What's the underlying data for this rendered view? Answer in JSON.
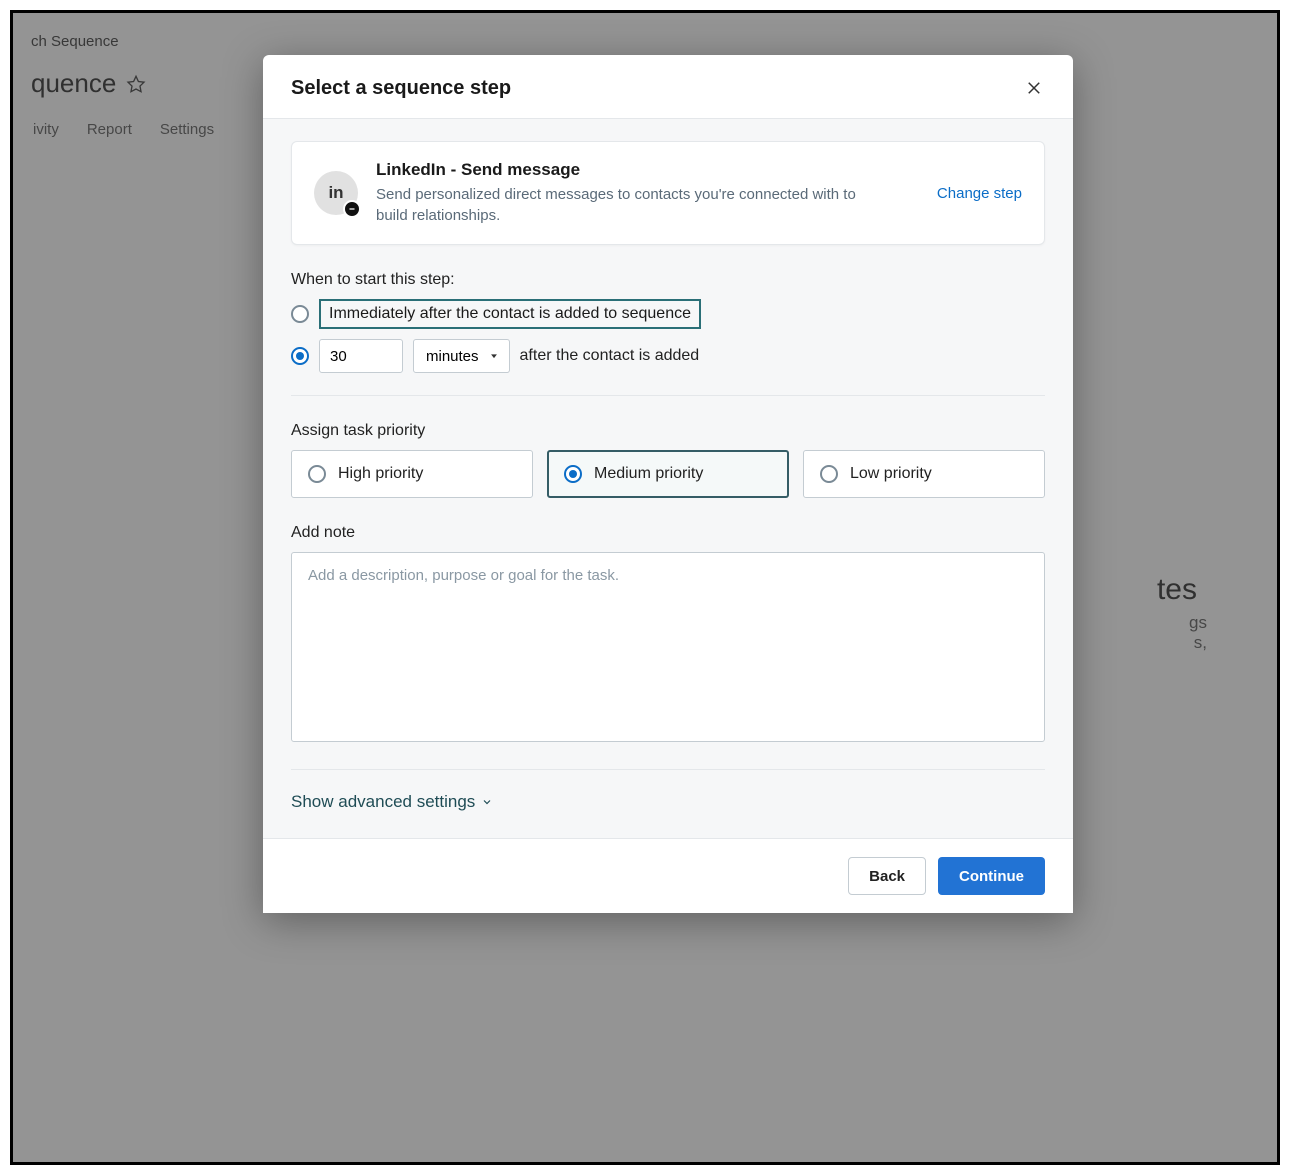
{
  "background": {
    "breadcrumb": "ch Sequence",
    "title": "quence",
    "tabs": [
      "ivity",
      "Report",
      "Settings"
    ],
    "right_heading_fragment": "tes",
    "right_sub1_fragment": "gs",
    "right_sub2_fragment": "s,"
  },
  "modal": {
    "title": "Select a sequence step",
    "step": {
      "icon_text": "in",
      "title": "LinkedIn - Send message",
      "description": "Send personalized direct messages to contacts you're connected with to build relationships.",
      "change_label": "Change step"
    },
    "when": {
      "label": "When to start this step:",
      "option_immediate": "Immediately after the contact is added to sequence",
      "delay_value": "30",
      "delay_unit": "minutes",
      "after_text": "after the contact is added",
      "selected": "delay"
    },
    "priority": {
      "label": "Assign task priority",
      "options": [
        "High priority",
        "Medium priority",
        "Low priority"
      ],
      "selected_index": 1
    },
    "note": {
      "label": "Add note",
      "placeholder": "Add a description, purpose or goal for the task."
    },
    "advanced_label": "Show advanced settings",
    "footer": {
      "back": "Back",
      "continue": "Continue"
    }
  }
}
